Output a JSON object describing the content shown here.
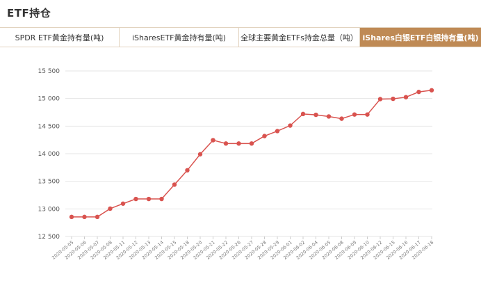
{
  "page": {
    "title": "ETF持仓"
  },
  "tabs": [
    {
      "label": "SPDR ETF黄金持有量(吨)",
      "active": false
    },
    {
      "label": "iSharesETF黄金持有量(吨)",
      "active": false
    },
    {
      "label": "全球主要黄金ETFs持金总量（吨）",
      "active": false
    },
    {
      "label": "iShares白银ETF白银持有量(吨)",
      "active": true
    }
  ],
  "colors": {
    "line": "#d9534f",
    "accent": "#bf8a55",
    "grid": "#e6e6e6"
  },
  "chart_data": {
    "type": "line",
    "title": "",
    "xlabel": "",
    "ylabel": "",
    "ylim": [
      12500,
      15500
    ],
    "yticks": [
      "12 500",
      "13 000",
      "13 500",
      "14 000",
      "14 500",
      "15 000",
      "15 500"
    ],
    "ytick_values": [
      12500,
      13000,
      13500,
      14000,
      14500,
      15000,
      15500
    ],
    "grid": true,
    "legend": "none",
    "x": [
      "2020-05-05",
      "2020-05-06",
      "2020-05-07",
      "2020-05-08",
      "2020-05-11",
      "2020-05-12",
      "2020-05-13",
      "2020-05-14",
      "2020-05-15",
      "2020-05-18",
      "2020-05-20",
      "2020-05-21",
      "2020-05-22",
      "2020-05-26",
      "2020-05-27",
      "2020-05-28",
      "2020-05-29",
      "2020-06-01",
      "2020-06-02",
      "2020-06-04",
      "2020-06-05",
      "2020-06-08",
      "2020-06-09",
      "2020-06-10",
      "2020-06-12",
      "2020-06-15",
      "2020-06-16",
      "2020-06-17",
      "2020-06-18"
    ],
    "series": [
      {
        "values": [
          12855,
          12855,
          12855,
          13005,
          13095,
          13180,
          13180,
          13180,
          13440,
          13700,
          13990,
          14245,
          14185,
          14185,
          14185,
          14320,
          14410,
          14510,
          14720,
          14705,
          14675,
          14635,
          14710,
          14710,
          14990,
          14995,
          15025,
          15120,
          15150
        ]
      }
    ]
  }
}
